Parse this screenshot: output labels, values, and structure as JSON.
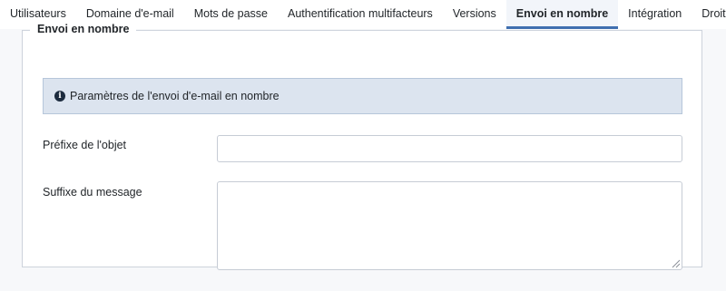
{
  "tabs": [
    {
      "label": "Utilisateurs",
      "active": false
    },
    {
      "label": "Domaine d'e-mail",
      "active": false
    },
    {
      "label": "Mots de passe",
      "active": false
    },
    {
      "label": "Authentification multifacteurs",
      "active": false
    },
    {
      "label": "Versions",
      "active": false
    },
    {
      "label": "Envoi en nombre",
      "active": true
    },
    {
      "label": "Intégration",
      "active": false
    },
    {
      "label": "Droits",
      "active": false
    }
  ],
  "section": {
    "legend": "Envoi en nombre",
    "info": {
      "icon": "info-icon",
      "text": "Paramètres de l'envoi d'e-mail en nombre"
    },
    "subject_prefix": {
      "label": "Préfixe de l'objet",
      "value": ""
    },
    "message_suffix": {
      "label": "Suffixe du message",
      "value": ""
    }
  },
  "colors": {
    "active_tab_underline": "#3f6fb0",
    "info_background": "#dce4ef"
  }
}
